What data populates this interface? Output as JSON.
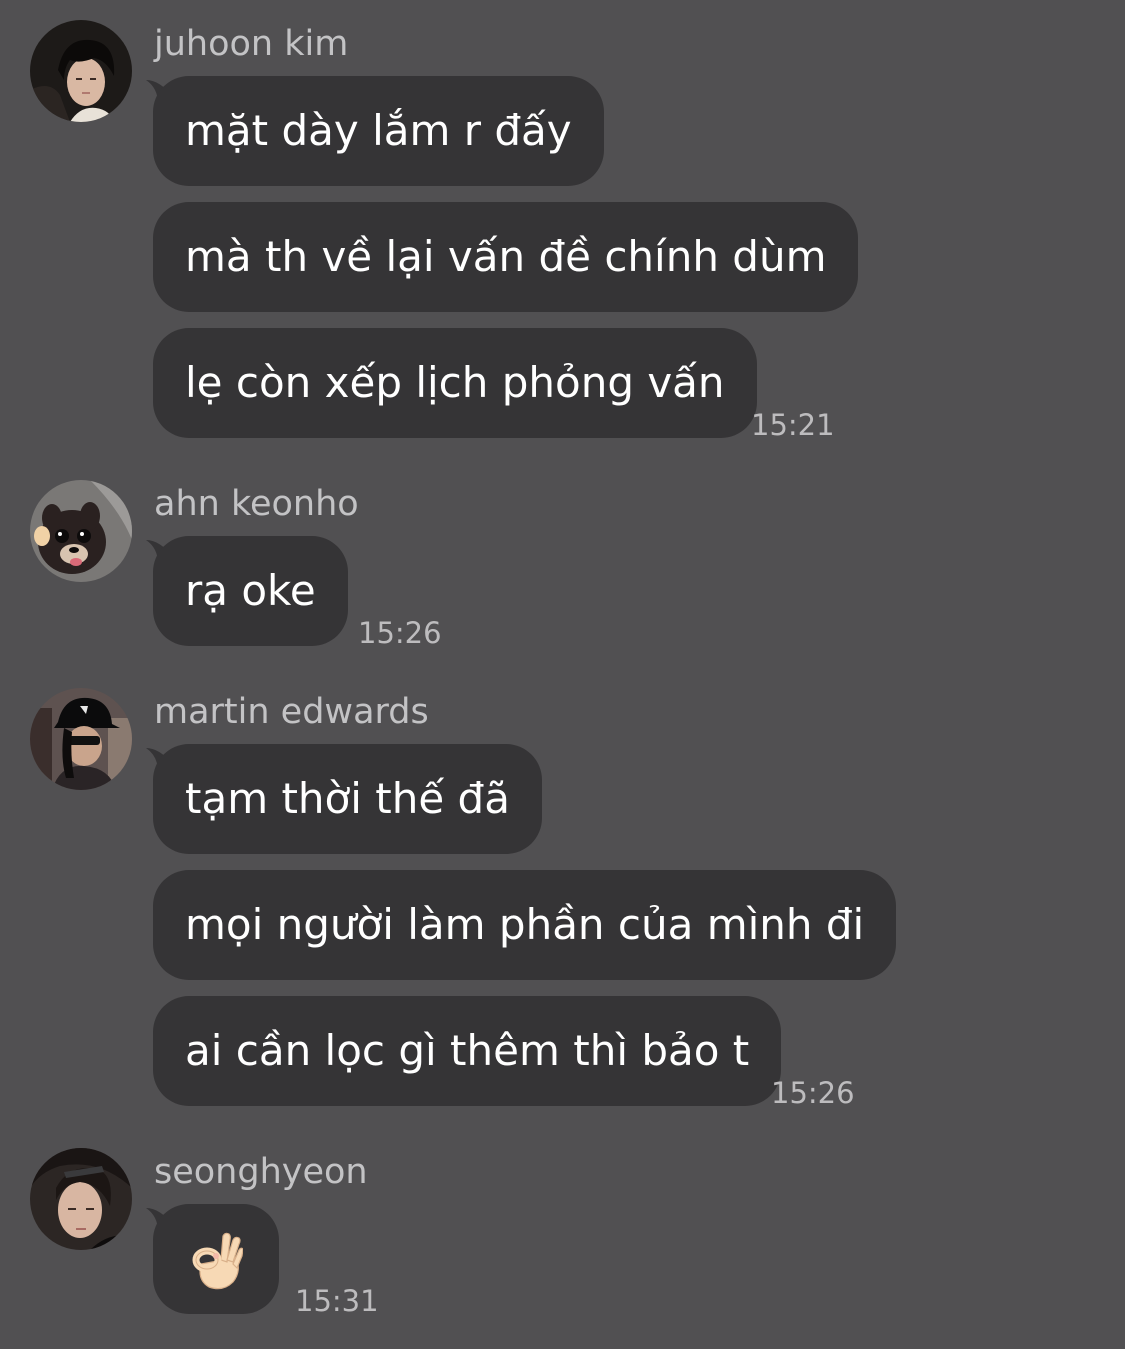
{
  "conversation": [
    {
      "sender": "juhoon kim",
      "avatar_icon": "avatar-photo-dark-hair",
      "messages": [
        "mặt dày lắm r đấy",
        "mà th về lại vấn đề chính dùm",
        "lẹ còn xếp lịch phỏng vấn"
      ],
      "time": "15:21"
    },
    {
      "sender": "ahn keonho",
      "avatar_icon": "avatar-photo-puppy",
      "messages": [
        "rạ oke"
      ],
      "time": "15:26"
    },
    {
      "sender": "martin edwards",
      "avatar_icon": "avatar-photo-black-cap",
      "messages": [
        "tạm thời thế đã",
        "mọi người làm phần của mình đi",
        "ai cần lọc gì thêm thì bảo t"
      ],
      "time": "15:26"
    },
    {
      "sender": "seonghyeon",
      "avatar_icon": "avatar-photo-sunglasses",
      "messages": [],
      "emoji": "ok-hand-emoji",
      "time": "15:31"
    }
  ],
  "colors": {
    "background": "#515052",
    "bubble": "#353436",
    "sender_text": "#c3c3c5",
    "time_text": "#bdbcbe",
    "message_text": "#ffffff"
  }
}
